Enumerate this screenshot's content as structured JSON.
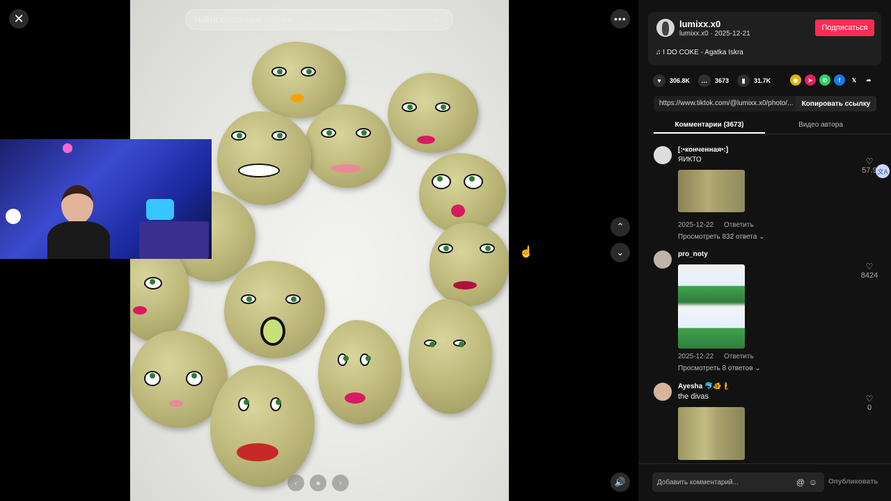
{
  "viewer": {
    "search_placeholder": "Найти связанный контент",
    "close_label": "✕",
    "more_label": "•••",
    "up_label": "⌃",
    "down_label": "⌄",
    "volume_label": "🔊",
    "prev_label": "‹",
    "dot_label": "●",
    "next_label": "›"
  },
  "author": {
    "name": "lumixx.x0",
    "sub": "lumixx.x0 · 2025-12-21",
    "subscribe_label": "Подписаться",
    "music": "♫  I DO COKE - Agatka Iskra"
  },
  "stats": {
    "likes": "306.8K",
    "comments": "3673",
    "saves": "31.7K"
  },
  "share_icons": [
    "coin-icon",
    "telegram-icon",
    "whatsapp-icon",
    "facebook-icon",
    "x-icon",
    "share-arrow-icon"
  ],
  "link": {
    "url": "https://www.tiktok.com/@lumixx.x0/photo/...",
    "copy_label": "Копировать ссылку"
  },
  "tabs": [
    {
      "label": "Комментарии (3673)",
      "active": true
    },
    {
      "label": "Видео автора",
      "active": false
    }
  ],
  "comments": [
    {
      "user": "[:•кончeнная•:]",
      "text": "ЯИКТО",
      "date": "2025-12-22",
      "reply_label": "Ответить",
      "replies": "Просмотреть 832 ответа ⌄",
      "likes": "57.9"
    },
    {
      "user": "pro_noty",
      "text": "",
      "date": "2025-12-22",
      "reply_label": "Ответить",
      "replies": "Просмотреть 8 ответов ⌄",
      "likes": "8424"
    },
    {
      "user": "Ayesha 🐬🐠🧜",
      "text": "the divas",
      "likes": "0"
    }
  ],
  "footer": {
    "input_placeholder": "Добавить комментарий...",
    "publish_label": "Опубликовать"
  },
  "colors": {
    "accent": "#fe2c55",
    "panel_bg": "#121212",
    "card_bg": "#1f1f1f"
  }
}
